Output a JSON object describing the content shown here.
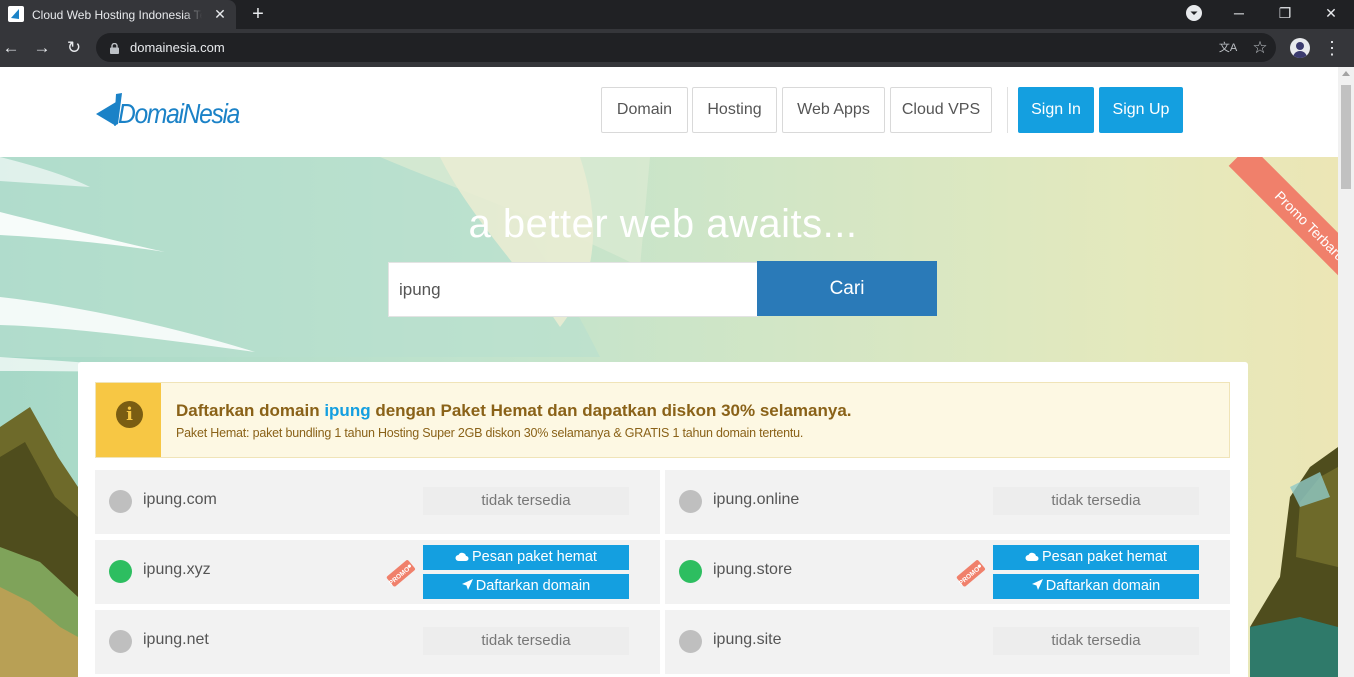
{
  "browser": {
    "tab_title": "Cloud Web Hosting Indonesia Te",
    "tab_close": "✕",
    "new_tab": "+",
    "url": "domainesia.com",
    "window_minimize": "─",
    "window_restore": "❐",
    "window_close": "✕",
    "back": "←",
    "forward": "→",
    "reload": "↻",
    "menu": "⋮",
    "translate_icon": "文A",
    "bookmark_icon": "☆"
  },
  "header": {
    "logo_text": "DomaiNesia",
    "nav": [
      "Domain",
      "Hosting",
      "Web Apps",
      "Cloud VPS"
    ],
    "sign_in": "Sign In",
    "sign_up": "Sign Up"
  },
  "hero": {
    "tagline": "a better web awaits...",
    "promo_ribbon": "Promo Terbaru",
    "search_value": "ipung",
    "search_button": "Cari"
  },
  "notice": {
    "icon": "i",
    "title_pre": "Daftarkan domain",
    "title_domain": "ipung",
    "title_post": "dengan Paket Hemat dan dapatkan diskon 30% selamanya.",
    "subtitle": "Paket Hemat: paket bundling 1 tahun Hosting Super 2GB diskon 30% selamanya & GRATIS 1 tahun domain tertentu."
  },
  "results": [
    {
      "domain": "ipung.com",
      "available": false,
      "status": "tidak tersedia"
    },
    {
      "domain": "ipung.online",
      "available": false,
      "status": "tidak tersedia"
    },
    {
      "domain": "ipung.xyz",
      "available": true,
      "promo_label": "PROMO",
      "btn_hemat": "Pesan paket hemat",
      "btn_daftar": "Daftarkan domain"
    },
    {
      "domain": "ipung.store",
      "available": true,
      "promo_label": "PROMO",
      "btn_hemat": "Pesan paket hemat",
      "btn_daftar": "Daftarkan domain"
    },
    {
      "domain": "ipung.net",
      "available": false,
      "status": "tidak tersedia"
    },
    {
      "domain": "ipung.site",
      "available": false,
      "status": "tidak tersedia"
    }
  ],
  "colors": {
    "brand_blue": "#149fe0",
    "search_button": "#2a7ab8",
    "available_dot": "#2dbe60",
    "unavailable_dot": "#bfbfbf",
    "promo_ribbon": "#f0806b",
    "notice_icon_bg": "#f7c744"
  },
  "icons": {
    "cloud": "cloud-icon",
    "paper_plane": "paper-plane-icon",
    "info": "info-circle-icon",
    "lock": "lock-icon",
    "promo_tag": "promo-tag-icon"
  }
}
